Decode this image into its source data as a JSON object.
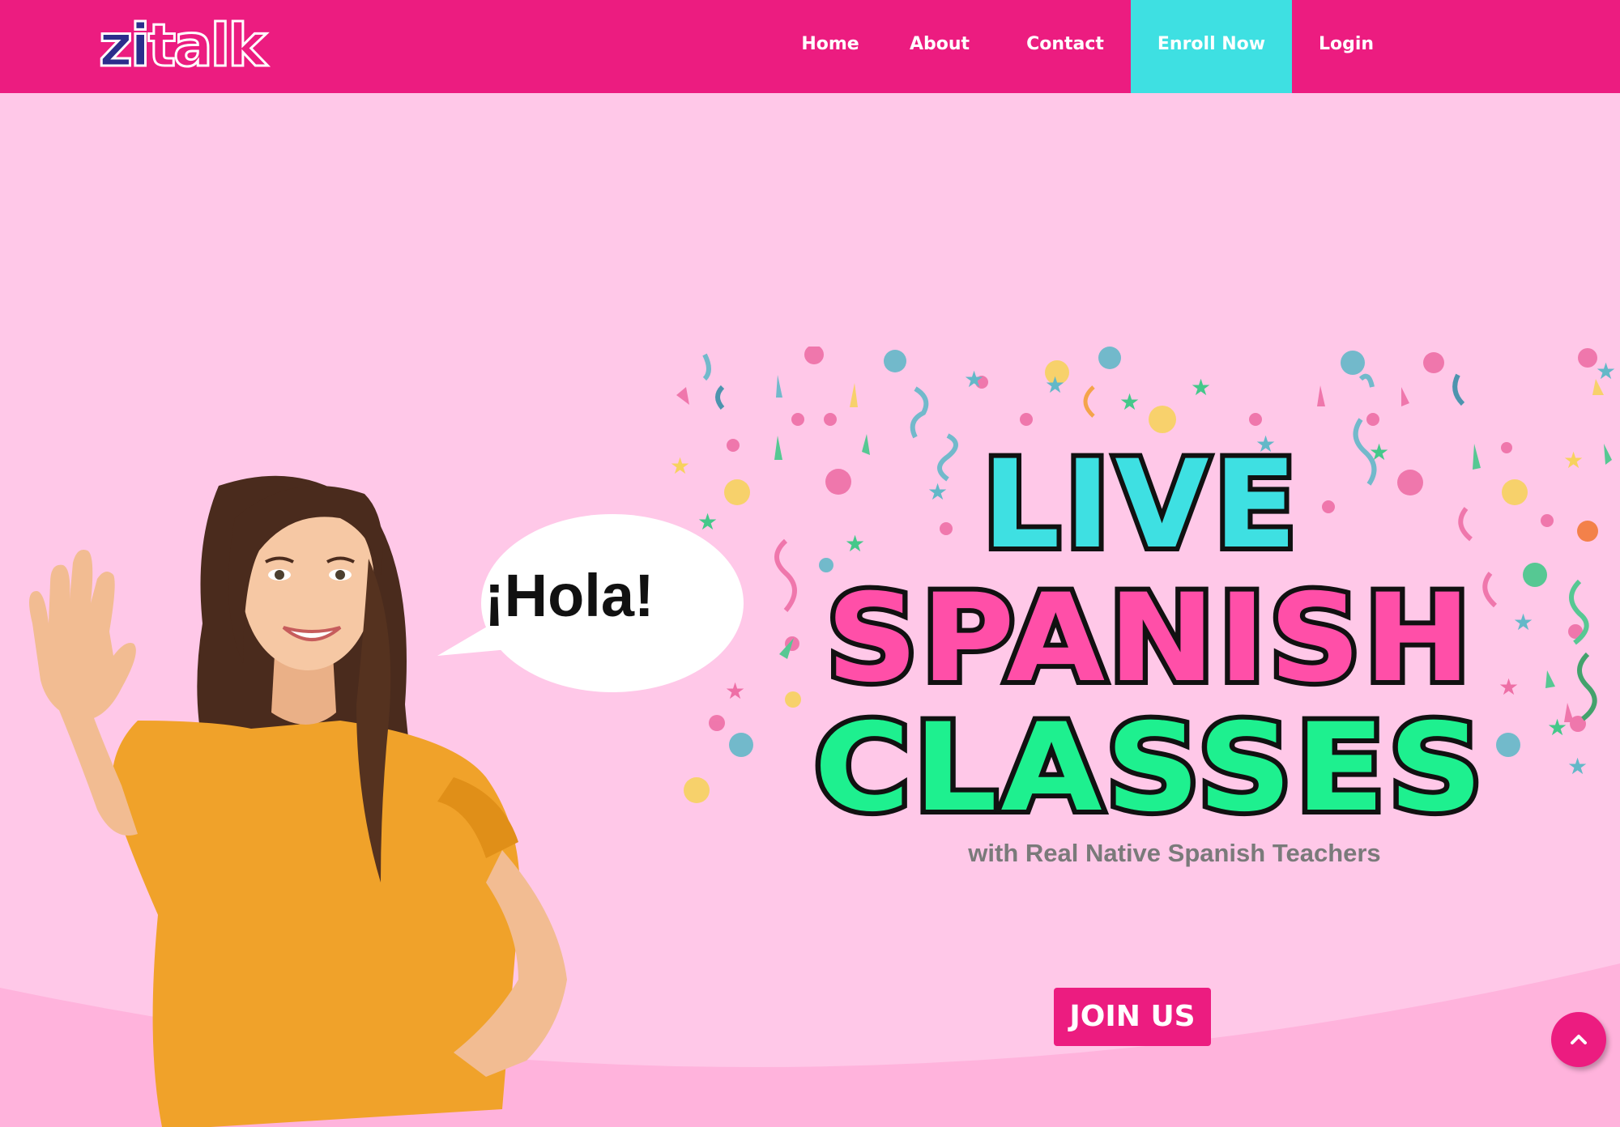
{
  "brand": {
    "logo_part1": "zi",
    "logo_part2": "talk"
  },
  "nav": {
    "items": [
      {
        "label": "Home"
      },
      {
        "label": "About"
      },
      {
        "label": "Contact"
      },
      {
        "label": "Enroll Now"
      },
      {
        "label": "Login"
      }
    ]
  },
  "hero": {
    "speech_bubble": "¡Hola!",
    "title_line1": "LIVE",
    "title_line2": "SPANISH",
    "title_line3": "CLASSES",
    "subtitle": "with Real Native Spanish Teachers",
    "cta_label": "JOIN US"
  },
  "icons": {
    "back_to_top": "chevron-up-icon"
  },
  "colors": {
    "nav_bg": "#ec1c80",
    "enroll_bg": "#3ee0e2",
    "page_bg": "#ffc8e8",
    "title_cyan": "#3ee0e2",
    "title_pink": "#ff4fa8",
    "title_green": "#1ef08f"
  }
}
